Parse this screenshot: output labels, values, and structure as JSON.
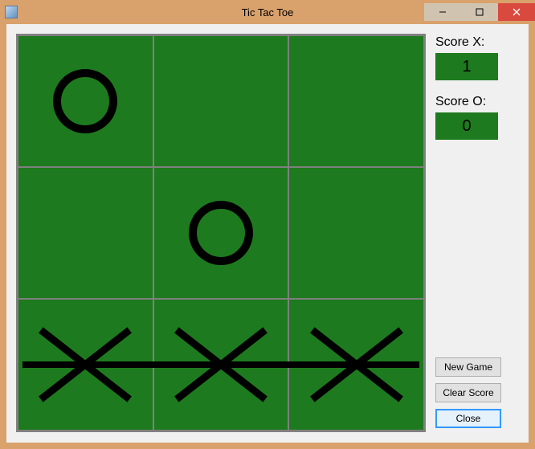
{
  "window": {
    "title": "Tic Tac Toe"
  },
  "score": {
    "label_x": "Score X:",
    "value_x": "1",
    "label_o": "Score O:",
    "value_o": "0"
  },
  "buttons": {
    "new_game": "New Game",
    "clear_score": "Clear Score",
    "close": "Close"
  },
  "board": {
    "cells": [
      "O",
      "",
      "",
      "",
      "O",
      "",
      "X",
      "X",
      "X"
    ],
    "winner": "X",
    "winning_line": "row-3"
  }
}
